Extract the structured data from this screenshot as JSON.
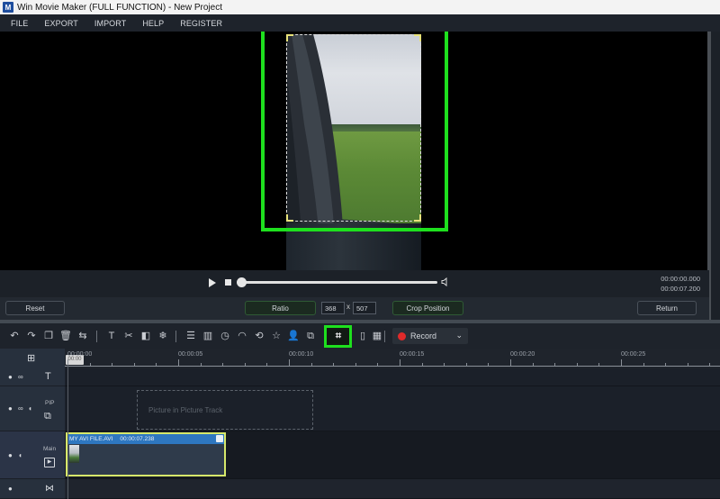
{
  "window": {
    "title": "Win Movie Maker (FULL FUNCTION) - New Project",
    "logo_glyph": "M"
  },
  "menu": [
    "FILE",
    "EXPORT",
    "IMPORT",
    "HELP",
    "REGISTER"
  ],
  "player": {
    "current_time": "00:00:00.000",
    "total_time": "00:00:07.200",
    "progress_fraction": 0.0
  },
  "crop_bar": {
    "reset_label": "Reset",
    "ratio_label": "Ratio",
    "width_value": "368",
    "times_sign": "x",
    "height_value": "507",
    "crop_position_label": "Crop Position",
    "return_label": "Return"
  },
  "toolbar": {
    "icons": [
      {
        "name": "undo-icon",
        "glyph": "↶"
      },
      {
        "name": "redo-icon",
        "glyph": "↷"
      },
      {
        "name": "copy-icon",
        "glyph": "❐"
      },
      {
        "name": "delete-icon",
        "glyph": "🗑"
      },
      {
        "name": "replace-icon",
        "glyph": "⇆"
      },
      {
        "name": "text-icon",
        "glyph": "T"
      },
      {
        "name": "cut-icon",
        "glyph": "✂"
      },
      {
        "name": "split-icon",
        "glyph": "◧"
      },
      {
        "name": "effects-icon",
        "glyph": "❄"
      },
      {
        "name": "adjust-icon",
        "glyph": "☰"
      },
      {
        "name": "columns-icon",
        "glyph": "▥"
      },
      {
        "name": "duration-icon",
        "glyph": "◷"
      },
      {
        "name": "speed-icon",
        "glyph": "◠"
      },
      {
        "name": "rotate-icon",
        "glyph": "⟲"
      },
      {
        "name": "sticker-icon",
        "glyph": "☆"
      },
      {
        "name": "person-icon",
        "glyph": "👤"
      },
      {
        "name": "export-clip-icon",
        "glyph": "⧉"
      },
      {
        "name": "crop-icon",
        "glyph": "⌗"
      },
      {
        "name": "save-frame-icon",
        "glyph": "▯"
      },
      {
        "name": "mosaic-icon",
        "glyph": "▦"
      }
    ],
    "record_label": "Record"
  },
  "timeline": {
    "playhead_time": "00:00",
    "ruler_labels": [
      "00:00:00",
      "00:00:05",
      "00:00:10",
      "00:00:15",
      "00:00:20",
      "00:00:25"
    ],
    "tracks": {
      "text": {
        "type_glyph": "T"
      },
      "pip": {
        "label": "PIP",
        "placeholder": "Picture in Picture Track"
      },
      "main": {
        "label": "Main",
        "clip_name": "MY AVI FILE.AVI",
        "clip_duration": "00:00:07.238"
      },
      "audio": {
        "type_glyph": "⋈"
      }
    }
  }
}
